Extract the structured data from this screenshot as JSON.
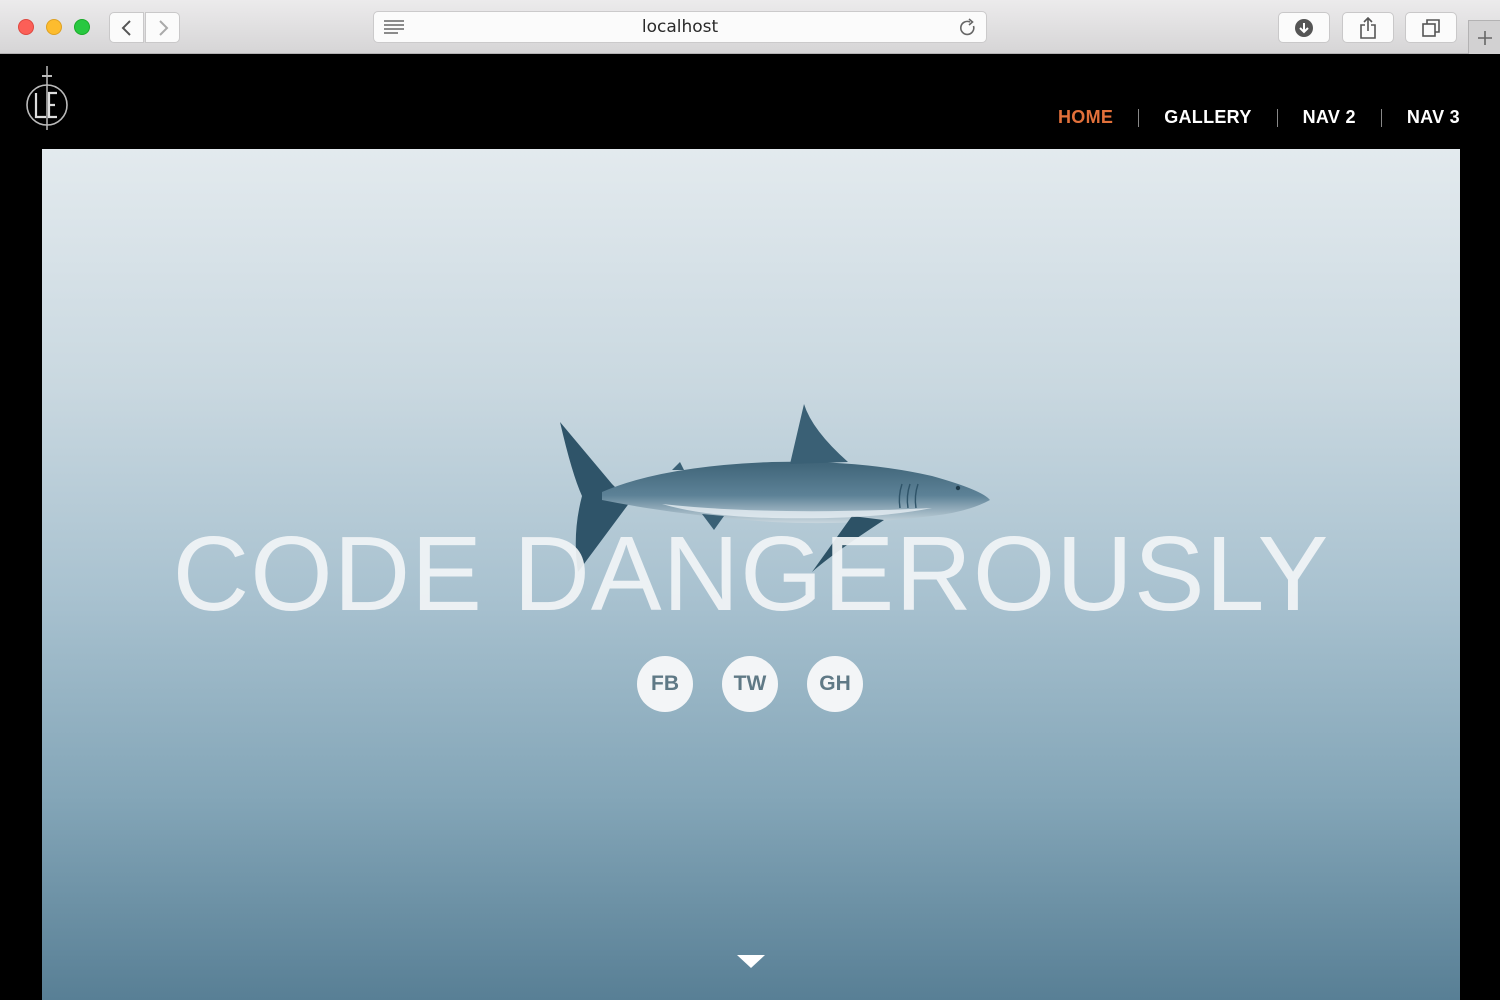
{
  "browser": {
    "url": "localhost",
    "colors": {
      "close": "#fc5f57",
      "minimize": "#fdbc2e",
      "zoom": "#28c840"
    },
    "icons": [
      "back-icon",
      "forward-icon",
      "reader-icon",
      "reload-icon",
      "download-icon",
      "share-icon",
      "tabs-icon",
      "new-tab-icon"
    ]
  },
  "site": {
    "logo_icon": "le-sword-logo",
    "nav": {
      "items": [
        {
          "label": "HOME",
          "active": true
        },
        {
          "label": "GALLERY",
          "active": false
        },
        {
          "label": "NAV 2",
          "active": false
        },
        {
          "label": "NAV 3",
          "active": false
        }
      ],
      "active_color": "#e2703a"
    },
    "hero": {
      "headline": "CODE DANGEROUSLY",
      "image": "shark-illustration",
      "socials": [
        {
          "label": "FB"
        },
        {
          "label": "TW"
        },
        {
          "label": "GH"
        }
      ],
      "scroll_icon": "down-arrow-icon"
    }
  }
}
